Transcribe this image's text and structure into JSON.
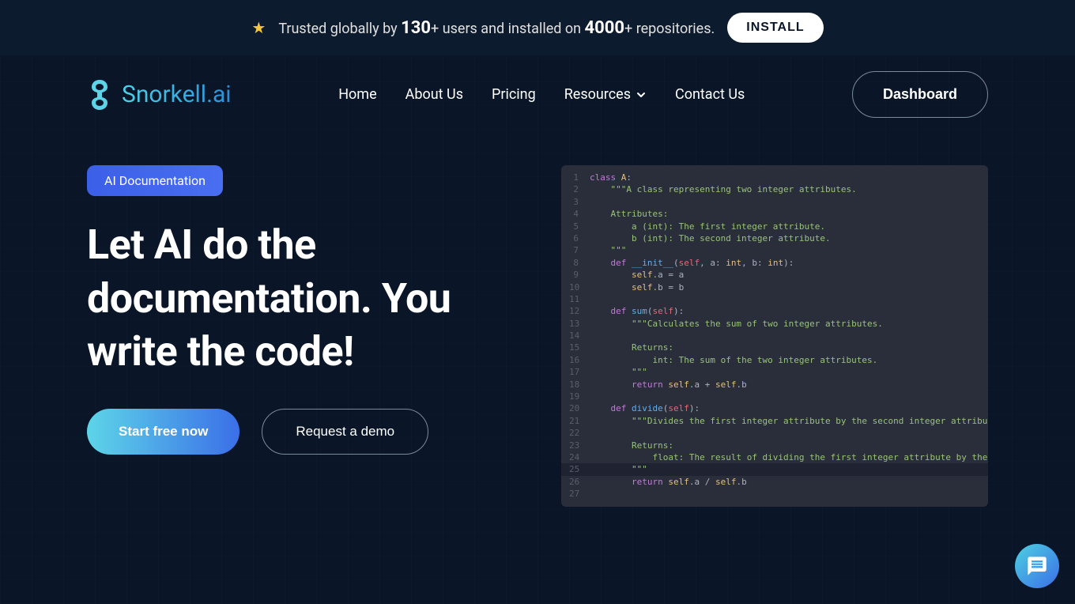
{
  "banner": {
    "trusted_text_1": "Trusted globally by ",
    "num_users": "130",
    "trusted_text_2": "+ users and installed on ",
    "num_repos": "4000",
    "trusted_text_3": "+ repositories.",
    "install_label": "INSTALL"
  },
  "logo": {
    "text": "Snorkell.ai"
  },
  "nav": {
    "home": "Home",
    "about": "About Us",
    "pricing": "Pricing",
    "resources": "Resources",
    "contact": "Contact Us",
    "dashboard": "Dashboard"
  },
  "hero": {
    "badge": "AI Documentation",
    "title": "Let AI do the documentation. You write the code!",
    "cta_primary": "Start free now",
    "cta_secondary": "Request a demo"
  },
  "code": {
    "lines": [
      {
        "n": 1,
        "h": false
      },
      {
        "n": 2,
        "h": false
      },
      {
        "n": 3,
        "h": false
      },
      {
        "n": 4,
        "h": false
      },
      {
        "n": 5,
        "h": false
      },
      {
        "n": 6,
        "h": false
      },
      {
        "n": 7,
        "h": false
      },
      {
        "n": 8,
        "h": false
      },
      {
        "n": 9,
        "h": false
      },
      {
        "n": 10,
        "h": false
      },
      {
        "n": 11,
        "h": false
      },
      {
        "n": 12,
        "h": false
      },
      {
        "n": 13,
        "h": false
      },
      {
        "n": 14,
        "h": false
      },
      {
        "n": 15,
        "h": false
      },
      {
        "n": 16,
        "h": false
      },
      {
        "n": 17,
        "h": false
      },
      {
        "n": 18,
        "h": false
      },
      {
        "n": 19,
        "h": false
      },
      {
        "n": 20,
        "h": false
      },
      {
        "n": 21,
        "h": false
      },
      {
        "n": 22,
        "h": false
      },
      {
        "n": 23,
        "h": false
      },
      {
        "n": 24,
        "h": false
      },
      {
        "n": 25,
        "h": true
      },
      {
        "n": 26,
        "h": false
      },
      {
        "n": 27,
        "h": false
      }
    ],
    "c1": "class A:",
    "c2": "    \"\"\"A class representing two integer attributes.",
    "c3": "",
    "c4": "    Attributes:",
    "c5": "        a (int): The first integer attribute.",
    "c6": "        b (int): The second integer attribute.",
    "c7": "    \"\"\"",
    "c8": "    def __init__(self, a: int, b: int):",
    "c9": "        self.a = a",
    "c10": "        self.b = b",
    "c11": "",
    "c12": "    def sum(self):",
    "c13": "        \"\"\"Calculates the sum of two integer attributes.",
    "c14": "",
    "c15": "        Returns:",
    "c16": "            int: The sum of the two integer attributes.",
    "c17": "        \"\"\"",
    "c18": "        return self.a + self.b",
    "c19": "",
    "c20": "    def divide(self):",
    "c21": "        \"\"\"Divides the first integer attribute by the second integer attribute.",
    "c22": "",
    "c23": "        Returns:",
    "c24": "            float: The result of dividing the first integer attribute by the second integer attribute.",
    "c25": "        \"\"\"",
    "c26": "        return self.a / self.b",
    "c27": ""
  }
}
